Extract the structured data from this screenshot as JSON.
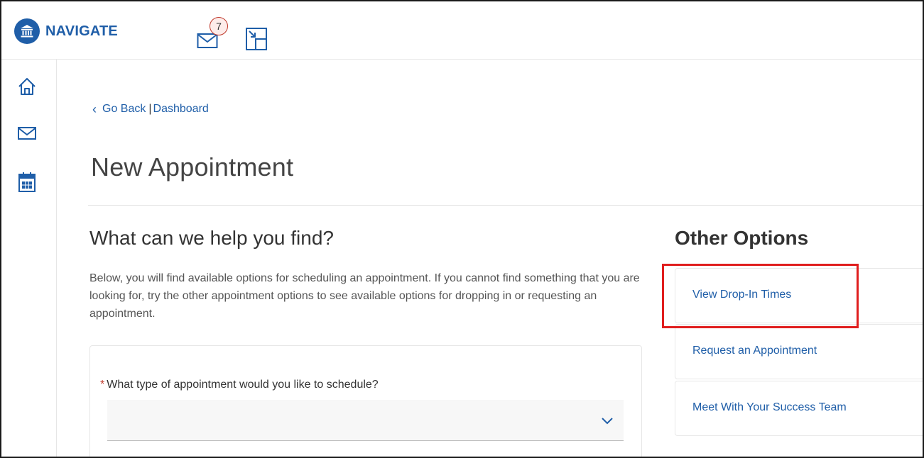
{
  "app": {
    "name": "NAVIGATE"
  },
  "header": {
    "messages_badge": "7"
  },
  "icons": {
    "logo": "university-building-icon",
    "mail": "envelope-icon",
    "resize": "resize-window-icon",
    "home": "home-icon",
    "messages": "envelope-icon",
    "calendar": "calendar-icon",
    "chevron": "chevron-down-icon"
  },
  "breadcrumb": {
    "back_label": "Go Back",
    "separator": "|",
    "current": "Dashboard"
  },
  "page": {
    "title": "New Appointment"
  },
  "finder": {
    "title": "What can we help you find?",
    "intro": "Below, you will find available options for scheduling an appointment. If you cannot find something that you are looking for, try the other appointment options to see available options for dropping in or requesting an appointment.",
    "field_required_marker": "*",
    "field_label": "What type of appointment would you like to schedule?",
    "field_value": ""
  },
  "other_options": {
    "title": "Other Options",
    "items": [
      {
        "label": "View Drop-In Times"
      },
      {
        "label": "Request an Appointment"
      },
      {
        "label": "Meet With Your Success Team"
      }
    ]
  },
  "colors": {
    "brand": "#1f5ea8",
    "highlight": "#e01e1e",
    "required": "#c0392b"
  }
}
